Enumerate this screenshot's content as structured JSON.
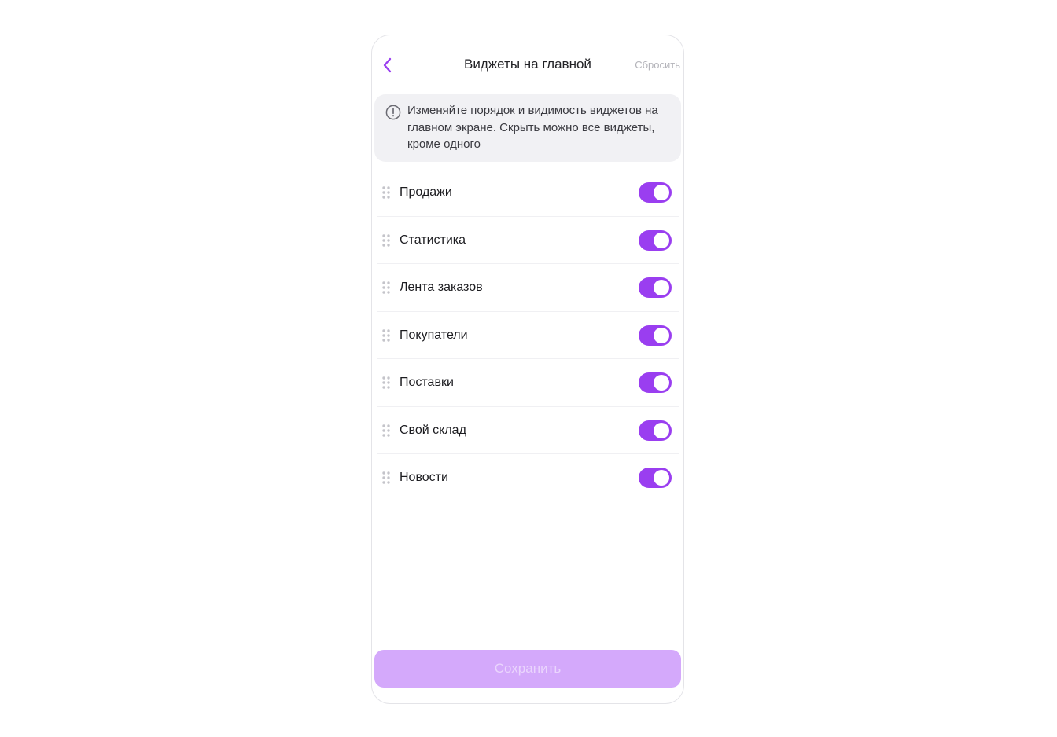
{
  "header": {
    "title": "Виджеты на главной",
    "reset_label": "Сбросить",
    "back_icon": "chevron-left-icon"
  },
  "info": {
    "icon": "info-circle-icon",
    "text": "Изменяйте порядок и видимость виджетов на главном экране. Скрыть можно все виджеты, кроме одного"
  },
  "widgets": [
    {
      "label": "Продажи",
      "enabled": true
    },
    {
      "label": "Статистика",
      "enabled": true
    },
    {
      "label": "Лента заказов",
      "enabled": true
    },
    {
      "label": "Покупатели",
      "enabled": true
    },
    {
      "label": "Поставки",
      "enabled": true
    },
    {
      "label": "Свой склад",
      "enabled": true
    },
    {
      "label": "Новости",
      "enabled": true
    }
  ],
  "footer": {
    "save_label": "Сохранить"
  },
  "colors": {
    "accent": "#9a3ef0",
    "save_disabled_bg": "#d4a9fb",
    "info_bg": "#f1f1f4"
  }
}
